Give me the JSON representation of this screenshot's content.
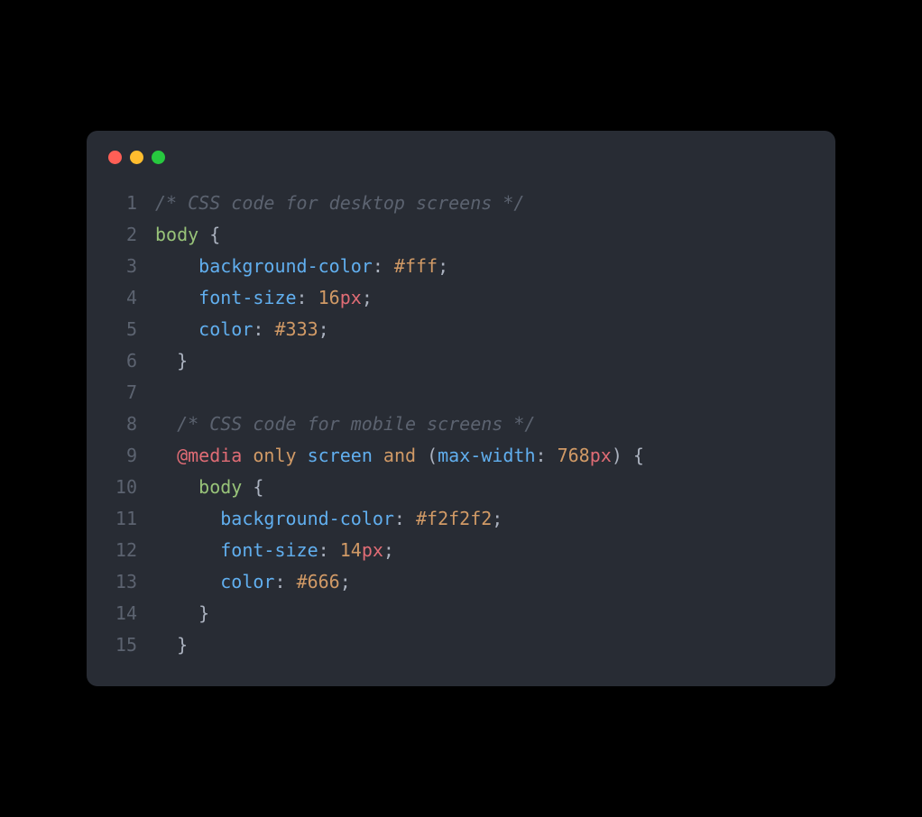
{
  "lines": [
    {
      "num": "1",
      "tokens": [
        [
          "",
          "comment",
          "/* CSS code for desktop screens */"
        ]
      ]
    },
    {
      "num": "2",
      "tokens": [
        [
          "",
          "selector",
          "body"
        ],
        [
          " ",
          "brace",
          "{"
        ]
      ]
    },
    {
      "num": "3",
      "tokens": [
        [
          "    ",
          "property",
          "background-color"
        ],
        [
          "",
          "punct",
          ":"
        ],
        [
          " ",
          "value",
          "#fff"
        ],
        [
          "",
          "punct",
          ";"
        ]
      ]
    },
    {
      "num": "4",
      "tokens": [
        [
          "    ",
          "property",
          "font-size"
        ],
        [
          "",
          "punct",
          ":"
        ],
        [
          " ",
          "number",
          "16"
        ],
        [
          "",
          "unit",
          "px"
        ],
        [
          "",
          "punct",
          ";"
        ]
      ]
    },
    {
      "num": "5",
      "tokens": [
        [
          "    ",
          "property",
          "color"
        ],
        [
          "",
          "punct",
          ":"
        ],
        [
          " ",
          "value",
          "#333"
        ],
        [
          "",
          "punct",
          ";"
        ]
      ]
    },
    {
      "num": "6",
      "tokens": [
        [
          "  ",
          "brace",
          "}"
        ]
      ]
    },
    {
      "num": "7",
      "tokens": []
    },
    {
      "num": "8",
      "tokens": [
        [
          "  ",
          "comment",
          "/* CSS code for mobile screens */"
        ]
      ]
    },
    {
      "num": "9",
      "tokens": [
        [
          "  ",
          "atrule",
          "@media"
        ],
        [
          " ",
          "mediakw",
          "only"
        ],
        [
          " ",
          "mediafeat",
          "screen"
        ],
        [
          " ",
          "mediakw",
          "and"
        ],
        [
          " ",
          "paren",
          "("
        ],
        [
          "",
          "mediafeat",
          "max-width"
        ],
        [
          "",
          "punct",
          ":"
        ],
        [
          " ",
          "number",
          "768"
        ],
        [
          "",
          "unit",
          "px"
        ],
        [
          "",
          "paren",
          ")"
        ],
        [
          " ",
          "brace",
          "{"
        ]
      ]
    },
    {
      "num": "10",
      "tokens": [
        [
          "    ",
          "selector",
          "body"
        ],
        [
          " ",
          "brace",
          "{"
        ]
      ]
    },
    {
      "num": "11",
      "tokens": [
        [
          "      ",
          "property",
          "background-color"
        ],
        [
          "",
          "punct",
          ":"
        ],
        [
          " ",
          "value",
          "#f2f2f2"
        ],
        [
          "",
          "punct",
          ";"
        ]
      ]
    },
    {
      "num": "12",
      "tokens": [
        [
          "      ",
          "property",
          "font-size"
        ],
        [
          "",
          "punct",
          ":"
        ],
        [
          " ",
          "number",
          "14"
        ],
        [
          "",
          "unit",
          "px"
        ],
        [
          "",
          "punct",
          ";"
        ]
      ]
    },
    {
      "num": "13",
      "tokens": [
        [
          "      ",
          "property",
          "color"
        ],
        [
          "",
          "punct",
          ":"
        ],
        [
          " ",
          "value",
          "#666"
        ],
        [
          "",
          "punct",
          ";"
        ]
      ]
    },
    {
      "num": "14",
      "tokens": [
        [
          "    ",
          "brace",
          "}"
        ]
      ]
    },
    {
      "num": "15",
      "tokens": [
        [
          "  ",
          "brace",
          "}"
        ]
      ]
    }
  ]
}
